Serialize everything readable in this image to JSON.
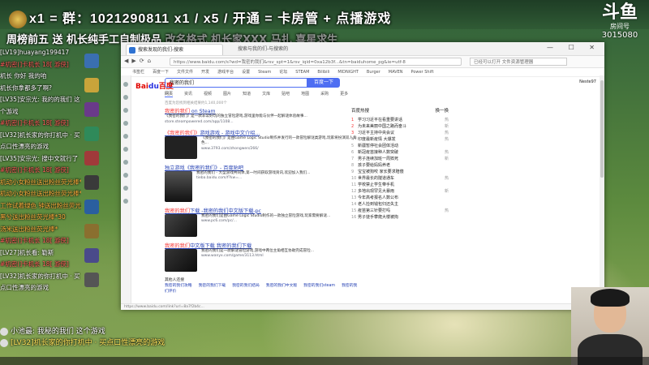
{
  "stream": {
    "banner": "x1 = 群：1021290811 x1 / x5 / 开通 = 卡房管 + 点播游戏",
    "sub_banner": "周榜前五 送 机长纯手工自制极品",
    "sub_banner_faded": "改名格式 机长家XXX 马扎 喜星求生",
    "platform_logo": "斗鱼",
    "platform_sub": "房间号",
    "room_number": "3015080"
  },
  "chat_left": [
    {
      "text": "[LV19]huayang199417",
      "color": "w"
    },
    {
      "text": "#机密(]卡机长 18[ 游侠]",
      "color": "r"
    },
    {
      "text": "机长 你好 我的咱",
      "color": "w"
    },
    {
      "text": "机长你拿都多了啊?",
      "color": "w"
    },
    {
      "text": "[LV35]安宗光: 我的的我们 这",
      "color": "w"
    },
    {
      "text": "个游戏",
      "color": "w"
    },
    {
      "text": "#机密(]卡机长 18[ 游侠]",
      "color": "r"
    },
    {
      "text": "[LV32]机长家的你打机中 · 买",
      "color": "w"
    },
    {
      "text": "点口性漂亮的游戏",
      "color": "w"
    },
    {
      "text": "[LV35]安宗光: 搜中文就行了",
      "color": "w"
    },
    {
      "text": "#机密(]卡机长 18[ 游侠]",
      "color": "r"
    },
    {
      "text": "机动小女粉丝送出粉丝荧光棒*",
      "color": "o"
    },
    {
      "text": "机动小女粉丝送出粉丝荧光棒*",
      "color": "o"
    },
    {
      "text": "工作试着绿色 钟送出粉丝荧光棒*10",
      "color": "o"
    },
    {
      "text": "黑兮送出粉丝荧光棒*30",
      "color": "o"
    },
    {
      "text": "汤米送出粉丝荧光棒*",
      "color": "o"
    },
    {
      "text": "",
      "color": "w"
    },
    {
      "text": "",
      "color": "w"
    },
    {
      "text": "#机密(]卡机长 18[ 游侠]",
      "color": "r"
    },
    {
      "text": "[LV27]机长看: 勒斯",
      "color": "w"
    },
    {
      "text": "#机密(]卡机长 18[ 游侠]",
      "color": "r"
    },
    {
      "text": "[LV32]机长家的你打机中 · 买",
      "color": "w"
    },
    {
      "text": "点口性漂亮的游戏",
      "color": "w"
    }
  ],
  "browser": {
    "tab_active": "搜索发现的我们-搜索",
    "tab_other": "搜索与我的们-与搜索的",
    "window_controls": "— ☐ ✕",
    "address": "https://www.baidu.com/s?wd=我密的我们&rsv_spt=1&rsv_iqid=0xa12b3f...&tn=baiduhome_pg&ie=utf-8",
    "right_box": "已经可以打开 文件资源管理器",
    "bookmarks": [
      "书签栏",
      "百度一下",
      "文件文件",
      "开发",
      "游戏平台",
      "设置",
      "Steam",
      "论坛",
      "STEAM",
      "Bilibili",
      "MIDNIGHT",
      "Burger",
      "MAVEN",
      "Power Shift"
    ],
    "status_url": "https://www.baidu.com/link?url=8a7f2b4c...",
    "search": {
      "logo_red": "Bai",
      "logo_blue": "du",
      "logo_suffix": "百度",
      "query": "我密的我们",
      "button": "百度一下",
      "user": "Neste97"
    },
    "tabs": [
      "网页",
      "资讯",
      "视频",
      "图片",
      "知道",
      "文库",
      "贴吧",
      "地图",
      "采购",
      "更多"
    ],
    "result_info": "百度为您找到相关结果约1,140,000个",
    "results": [
      {
        "title_hl": "我密的我们",
        "title_rest": " on Steam",
        "desc": "《我密的我们》是一款非常好玩的独立冒险游戏,游戏里你能与伙伴一起解谜体验故事...",
        "url": "store.steampowered.com/app/1108..."
      },
      {
        "title_hl": "《我密的我们》",
        "title_rest": "游戏游戏 - 游戏中文介绍...",
        "desc": "《我密的我们》是由Game Logic Studio制作并发行的一款冒险解谜类游戏,玩家将扮演双人角色...",
        "url": "www.3793.com/zhongwen/266/"
      },
      {
        "title_hl": "",
        "title_rest": "独立游戏《我密的我们》- 百度贴吧",
        "desc": "我密的我们 - 大型游戏共同体,第一时间获取游戏资讯,欢迎加入我们...",
        "url": "tieba.baidu.com/f?kw=..."
      },
      {
        "title_hl": "我密的我们",
        "title_rest": "下载 -我密的我们中文版下载-pc",
        "desc": "我密的我们是由Game Logic Studio制作的一款独立冒险游戏,玩家需要解谜...",
        "url": "www.pc6.com/pc/..."
      },
      {
        "title_hl": "我密的我们",
        "title_rest": "中文版下载 我密的我们下载",
        "desc": "我密的我们是一款解谜冒险游戏,游戏中两位主角相互协助完成冒险...",
        "url": "www.wanyx.com/game/3113.html"
      }
    ],
    "related_title": "其他人还搜",
    "related": [
      "我密的我们攻略",
      "我密的我们下载",
      "我密的我们结局",
      "我密的我们中文版",
      "我密的我们steam",
      "我密的我们评价"
    ],
    "hot_title": "百度热搜",
    "hot_refresh": "换一换",
    "hot_list": [
      {
        "n": "1",
        "t": "学习习近平在看重要讲话",
        "v": "热"
      },
      {
        "n": "2",
        "t": "为未来美丽中国之路而奋斗",
        "v": "新"
      },
      {
        "n": "3",
        "t": "习近平主持中央会议",
        "v": "热"
      },
      {
        "n": "4",
        "t": "印度最新疫情 大爆发",
        "v": "热"
      },
      {
        "n": "5",
        "t": "新疆暂停社会团体活动",
        "v": ""
      },
      {
        "n": "6",
        "t": "新冠疫苗接种人数突破",
        "v": "热"
      },
      {
        "n": "7",
        "t": "男子连续加班一周猝死",
        "v": "新"
      },
      {
        "n": "8",
        "t": "孩子要给妈妈养老",
        "v": ""
      },
      {
        "n": "9",
        "t": "宝宝被狗咬 家长要求赔偿",
        "v": ""
      },
      {
        "n": "10",
        "t": "世界最长的隧道通车",
        "v": "热"
      },
      {
        "n": "11",
        "t": "学校禁止学生带手机",
        "v": ""
      },
      {
        "n": "12",
        "t": "多地出现罕见大暴雨",
        "v": "新"
      },
      {
        "n": "13",
        "t": "今年高考报名人数公布",
        "v": ""
      },
      {
        "n": "14",
        "t": "老人捡到钱包归还失主",
        "v": ""
      },
      {
        "n": "15",
        "t": "疫苗第三针要打吗",
        "v": "热"
      },
      {
        "n": "16",
        "t": "男子徒手攀爬大楼被拘",
        "v": ""
      }
    ]
  },
  "chat_bottom": [
    {
      "text": "小池最: 我秘的我们 这个游戏",
      "color": "w"
    },
    {
      "text": "[LV32]机长家的你打机中 · 买点口性漂亮的游戏",
      "color": "y"
    }
  ]
}
